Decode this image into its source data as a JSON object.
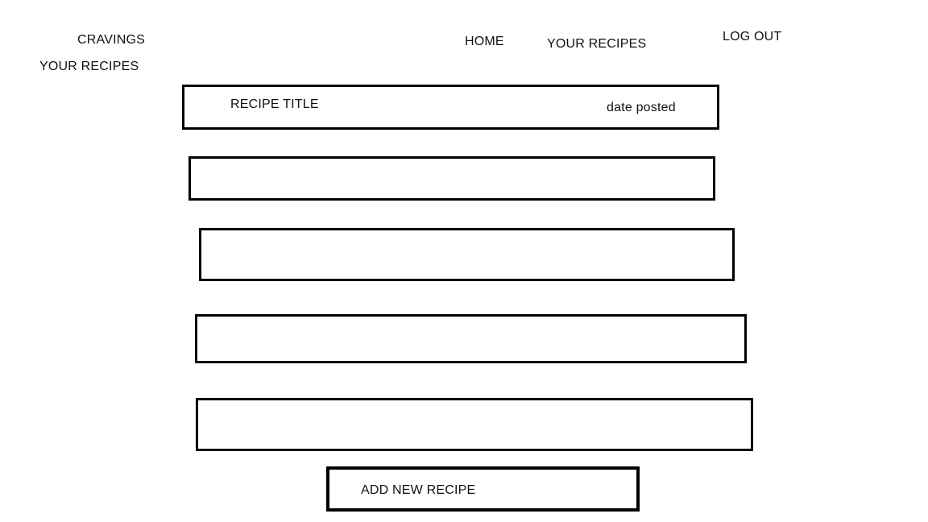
{
  "brand": {
    "name": "CRAVINGS"
  },
  "page": {
    "heading": "YOUR RECIPES"
  },
  "nav": {
    "home": "HOME",
    "your_recipes": "YOUR RECIPES",
    "logout": "LOG OUT"
  },
  "recipes": [
    {
      "title": "RECIPE TITLE",
      "date": "date posted"
    },
    {
      "title": "",
      "date": ""
    },
    {
      "title": "",
      "date": ""
    },
    {
      "title": "",
      "date": ""
    },
    {
      "title": "",
      "date": ""
    }
  ],
  "actions": {
    "add_new": "ADD NEW RECIPE"
  }
}
